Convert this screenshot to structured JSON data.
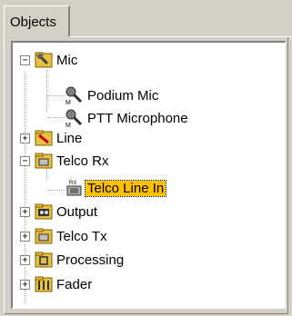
{
  "tab": {
    "label": "Objects"
  },
  "tree": {
    "mic": {
      "label": "Mic",
      "expanded": true,
      "children": [
        {
          "label": "Podium Mic"
        },
        {
          "label": "PTT Microphone"
        }
      ]
    },
    "line": {
      "label": "Line",
      "expanded": false
    },
    "telco_rx": {
      "label": "Telco Rx",
      "expanded": true,
      "children": [
        {
          "label": "Telco Line In",
          "selected": true
        }
      ]
    },
    "output": {
      "label": "Output",
      "expanded": false
    },
    "telco_tx": {
      "label": "Telco Tx",
      "expanded": false
    },
    "processing": {
      "label": "Processing",
      "expanded": false
    },
    "fader": {
      "label": "Fader",
      "expanded": false
    }
  },
  "glyphs": {
    "expanded": "−",
    "collapsed": "+",
    "mic_sub": "M",
    "rx_sub": "RX"
  },
  "colors": {
    "folder": "#e8c040",
    "selection": "#ffc000",
    "background": "#d4d0c8"
  }
}
